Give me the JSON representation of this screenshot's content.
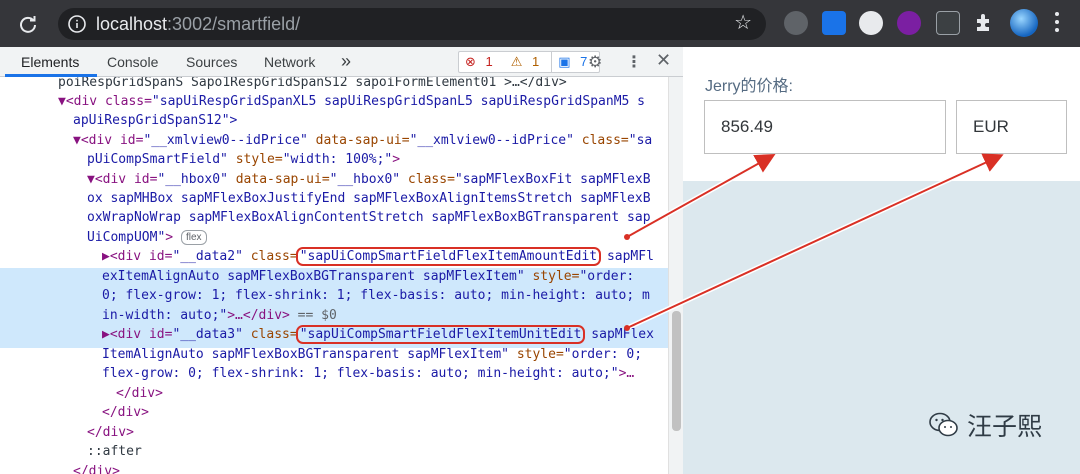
{
  "browser": {
    "url_host": "localhost",
    "url_rest": ":3002/smartfield/",
    "extensions": [
      "translate-extension-icon",
      "edit-extension-icon",
      "alarm-extension-icon",
      "vpn-extension-icon",
      "terminal-extension-icon",
      "puzzle-icon",
      "profile-avatar"
    ]
  },
  "devtools": {
    "tabs": [
      "Elements",
      "Console",
      "Sources",
      "Network"
    ],
    "active_tab": "Elements",
    "more_tabs": "»",
    "counters": {
      "errors": "1",
      "warnings": "1",
      "messages": "7"
    },
    "code_lines": {
      "l0": "poiRespGridSpanS Sapo1RespGridSpanS12 sapoiFormElement01 >…</div>",
      "l1_a": "▼<div class=",
      "l1_b": "\"sapUiRespGridSpanXL5 sapUiRespGridSpanL5 sapUiRespGridSpanM5 s",
      "l2": "apUiRespGridSpanS12\">",
      "l3_a": "▼<div id=",
      "l3_b": "\"__xmlview0--idPrice\"",
      "l3_c": " data-sap-ui=",
      "l3_d": "\"__xmlview0--idPrice\"",
      "l3_e": " class=",
      "l3_f": "\"sa",
      "l4_a": "pUiCompSmartField\"",
      "l4_b": " style=",
      "l4_c": "\"width: 100%;\"",
      "l4_d": ">",
      "l5_a": "▼<div id=",
      "l5_b": "\"__hbox0\"",
      "l5_c": " data-sap-ui=",
      "l5_d": "\"__hbox0\"",
      "l5_e": " class=",
      "l5_f": "\"sapMFlexBoxFit sapMFlexB",
      "l6": "ox sapMHBox sapMFlexBoxJustifyEnd sapMFlexBoxAlignItemsStretch sapMFlexB",
      "l7": "oxWrapNoWrap sapMFlexBoxAlignContentStretch sapMFlexBoxBGTransparent sap",
      "l8_a": "UiCompUOM\"",
      "l8_b": ">",
      "l8_badge": "flex",
      "l9_a": "▶<div id=",
      "l9_b": "\"__data2\"",
      "l9_c": " class=",
      "l9_d": "\"sapUiCompSmartFieldFlexItemAmountEdit",
      "l9_e": " sapMFl",
      "l10": "exItemAlignAuto sapMFlexBoxBGTransparent sapMFlexItem\"",
      "l10_b": " style=",
      "l10_c": "\"order:",
      "l11": "0; flex-grow: 1; flex-shrink: 1; flex-basis: auto; min-height: auto; m",
      "l12_a": "in-width: auto;\"",
      "l12_b": ">…</div>",
      "l12_c": " == $0",
      "l13_a": "▶<div id=",
      "l13_b": "\"__data3\"",
      "l13_c": " class=",
      "l13_d": "\"sapUiCompSmartFieldFlexItemUnitEdit",
      "l13_e": " sapMFlex",
      "l14": "ItemAlignAuto sapMFlexBoxBGTransparent sapMFlexItem\"",
      "l14_b": " style=",
      "l14_c": "\"order: 0;",
      "l15": "flex-grow: 0; flex-shrink: 1; flex-basis: auto; min-height: auto;\"",
      "l15_b": ">…",
      "l16": "</div>",
      "l17": "</div>",
      "l18": "</div>",
      "l19": "::after",
      "l20": "</div>"
    }
  },
  "app": {
    "label": "Jerry的价格:",
    "amount_value": "856.49",
    "unit_value": "EUR"
  },
  "watermark": {
    "text": "汪子熙"
  },
  "annotation_color": "#d93025"
}
